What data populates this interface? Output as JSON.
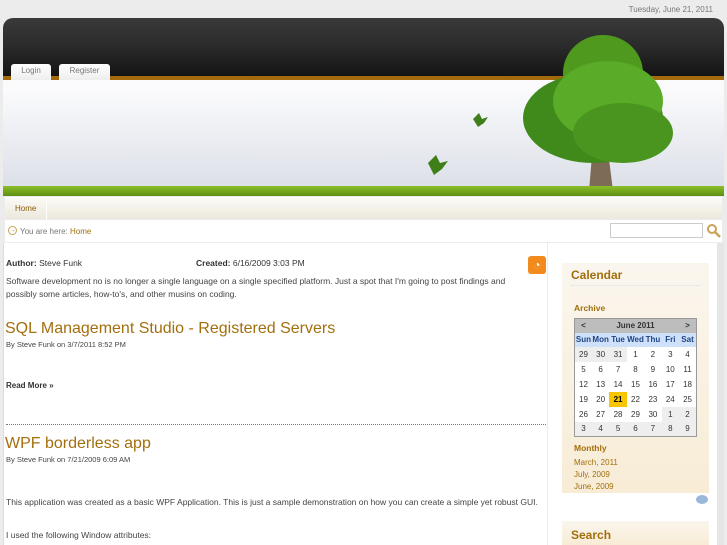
{
  "date": "Tuesday, June 21, 2011",
  "tabs": {
    "login": "Login",
    "register": "Register"
  },
  "nav": {
    "home": "Home"
  },
  "breadcrumb": {
    "label": "You are here:",
    "current": "Home"
  },
  "search": {
    "value": "",
    "placeholder": ""
  },
  "intro": {
    "author_label": "Author:",
    "author": "Steve Funk",
    "created_label": "Created:",
    "created": "6/16/2009 3:03 PM",
    "text": "Software development no is no longer a single language on a single specified platform. Just a spot that I'm going to post findings and possibly some articles, how-to's, and other musins on coding."
  },
  "posts": [
    {
      "title": "SQL Management Studio - Registered Servers",
      "meta": "By Steve Funk on 3/7/2011 8:52 PM",
      "read_more": "Read More »"
    },
    {
      "title": "WPF borderless app",
      "meta": "By Steve Funk on 7/21/2009 6:09 AM",
      "p1": "This application was created as a basic WPF Application.  This is just a sample demonstration on how you can create a simple yet robust GUI.",
      "p2": "I used the following Window attributes:"
    }
  ],
  "calendar": {
    "title": "Calendar",
    "archive": "Archive",
    "prev": "<",
    "next": ">",
    "month": "June 2011",
    "days": [
      "Sun",
      "Mon",
      "Tue",
      "Wed",
      "Thu",
      "Fri",
      "Sat"
    ],
    "weeks": [
      [
        "29",
        "30",
        "31",
        "1",
        "2",
        "3",
        "4"
      ],
      [
        "5",
        "6",
        "7",
        "8",
        "9",
        "10",
        "11"
      ],
      [
        "12",
        "13",
        "14",
        "15",
        "16",
        "17",
        "18"
      ],
      [
        "19",
        "20",
        "21",
        "22",
        "23",
        "24",
        "25"
      ],
      [
        "26",
        "27",
        "28",
        "29",
        "30",
        "1",
        "2"
      ],
      [
        "3",
        "4",
        "5",
        "6",
        "7",
        "8",
        "9"
      ]
    ],
    "today": "21",
    "monthly": "Monthly",
    "months": [
      "March, 2011",
      "July, 2009",
      "June, 2009"
    ]
  },
  "search_panel": {
    "title": "Search"
  }
}
